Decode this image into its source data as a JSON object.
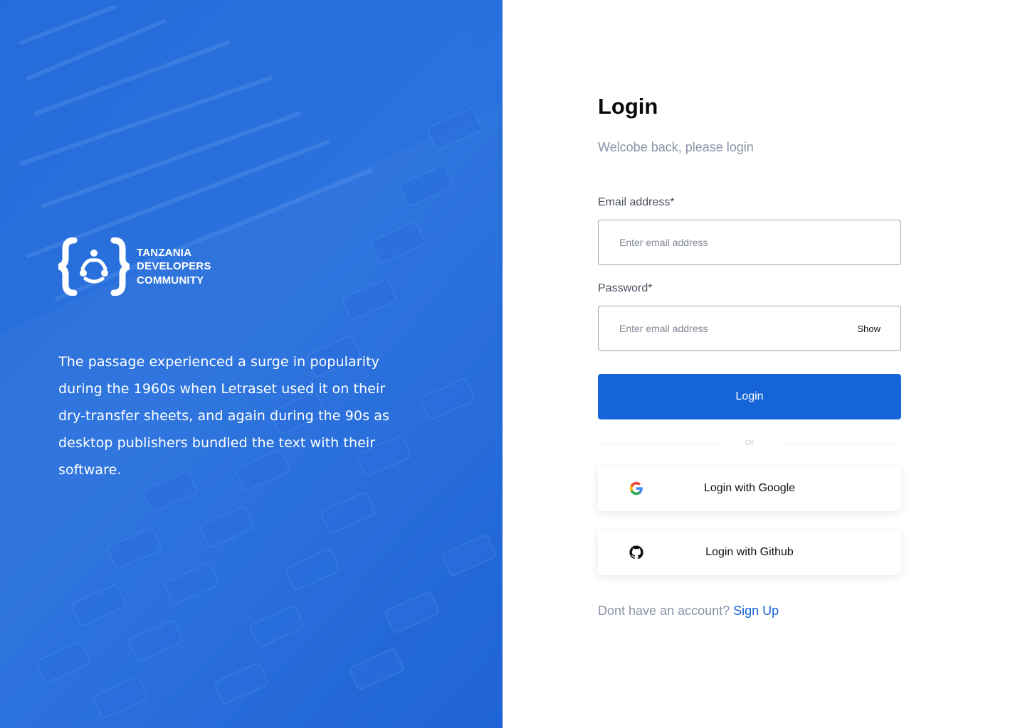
{
  "brand": {
    "lines": [
      "TANZANIA",
      "DEVELOPERS",
      "COMMUNITY"
    ],
    "description": "The passage experienced a surge in popularity during the 1960s when Letraset used it on their dry-transfer sheets, and again during the 90s as desktop publishers bundled the text with their software."
  },
  "login": {
    "title": "Login",
    "subtitle": "Welcobe back, please login",
    "email_label": "Email address*",
    "email_placeholder": "Enter email address",
    "email_value": "",
    "password_label": "Password*",
    "password_placeholder": "Enter email address",
    "password_value": "",
    "show_label": "Show",
    "submit_label": "Login",
    "divider_label": "Or",
    "google_label": "Login with Google",
    "github_label": "Login with Github",
    "signup_prompt": "Dont have an account?",
    "signup_link": "Sign Up"
  },
  "icons": {
    "google": "google-icon",
    "github": "github-icon",
    "logo": "tanzania-developers-logo"
  },
  "colors": {
    "brand_blue": "#1565d8",
    "panel_blue": "#1f63d6",
    "muted_text": "#8a93a6"
  }
}
